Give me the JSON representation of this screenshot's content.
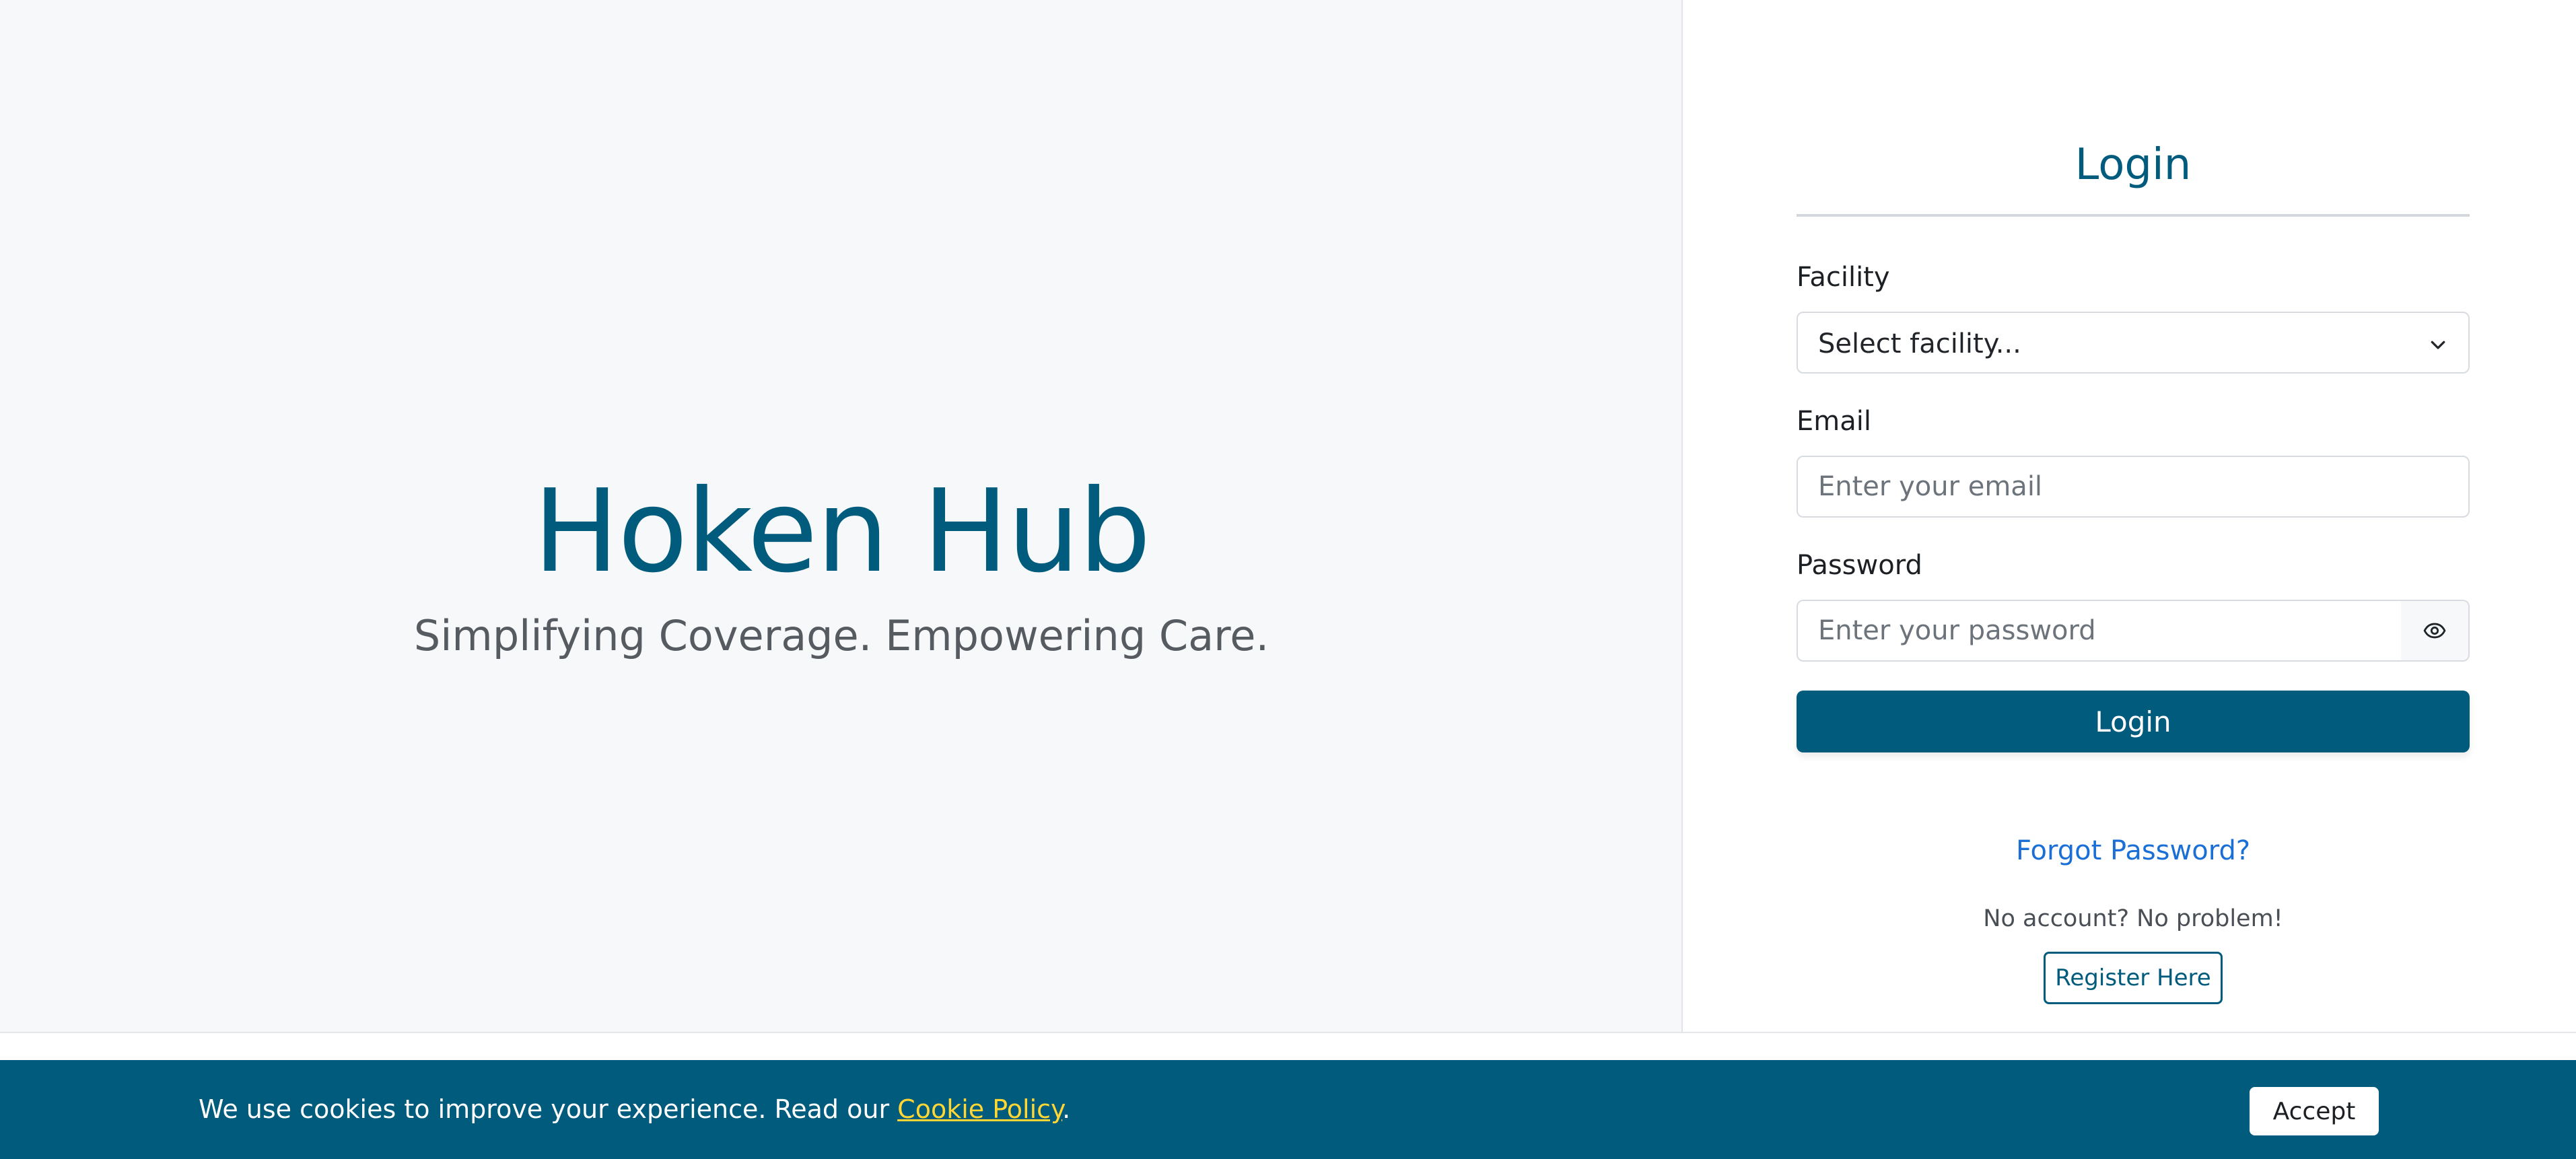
{
  "hero": {
    "title": "Hoken Hub",
    "subtitle": "Simplifying Coverage. Empowering Care."
  },
  "login": {
    "title": "Login",
    "facility": {
      "label": "Facility",
      "selected": "Select facility...",
      "icon": "chevron-down-icon"
    },
    "email": {
      "label": "Email",
      "placeholder": "Enter your email",
      "value": ""
    },
    "password": {
      "label": "Password",
      "placeholder": "Enter your password",
      "value": "",
      "toggle_icon": "eye-icon"
    },
    "submit_label": "Login",
    "forgot_password": "Forgot Password?",
    "no_account_text": "No account? No problem!",
    "register_label": "Register Here"
  },
  "cookie_banner": {
    "text_before": "We use cookies to improve your experience. Read our ",
    "link_text": "Cookie Policy",
    "text_after": ".",
    "accept_label": "Accept"
  },
  "colors": {
    "brand": "#015b7d",
    "link": "#1a6fd6",
    "cookie_link": "#ffd633",
    "hero_bg": "#f7f8fa"
  }
}
